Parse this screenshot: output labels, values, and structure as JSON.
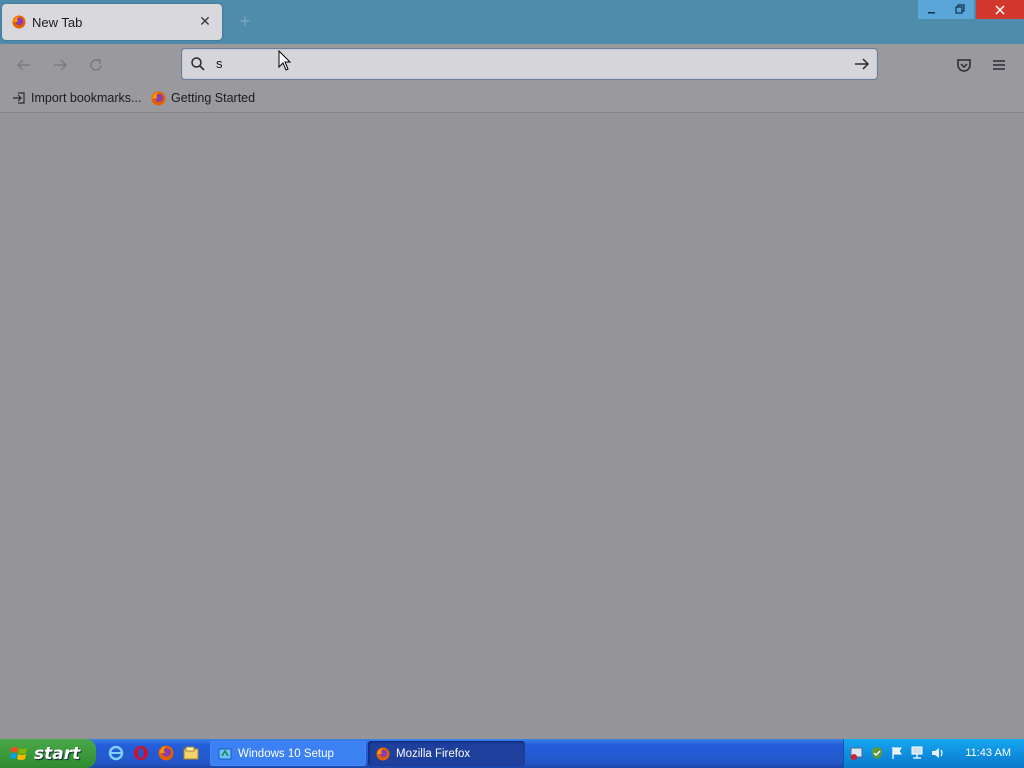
{
  "tab": {
    "title": "New Tab",
    "close_glyph": "✕",
    "new_tab_glyph": "+"
  },
  "window_controls": {
    "minimize": "minimize-icon",
    "maximize": "restore-icon",
    "close": "close-icon"
  },
  "nav": {
    "back": "back-arrow-icon",
    "forward": "forward-arrow-icon",
    "reload": "reload-icon",
    "url_value": "s",
    "pocket": "pocket-icon",
    "menu": "hamburger-menu-icon"
  },
  "bookmarks": [
    {
      "label": "Import bookmarks...",
      "icon": "import-icon"
    },
    {
      "label": "Getting Started",
      "icon": "firefox-icon"
    }
  ],
  "taskbar": {
    "start_label": "start",
    "quick_launch": [
      "internet-explorer-icon",
      "opera-icon",
      "firefox-icon",
      "file-explorer-icon"
    ],
    "tasks": [
      {
        "label": "Windows 10 Setup",
        "active": false
      },
      {
        "label": "Mozilla Firefox",
        "active": true
      }
    ],
    "clock": "11:43 AM"
  },
  "colors": {
    "titlebar": "#4e8cac",
    "toolbar": "#9a999e",
    "content": "#959499",
    "taskbar": "#245edb",
    "start": "#3c9b3c",
    "close_button": "#d2382e"
  }
}
